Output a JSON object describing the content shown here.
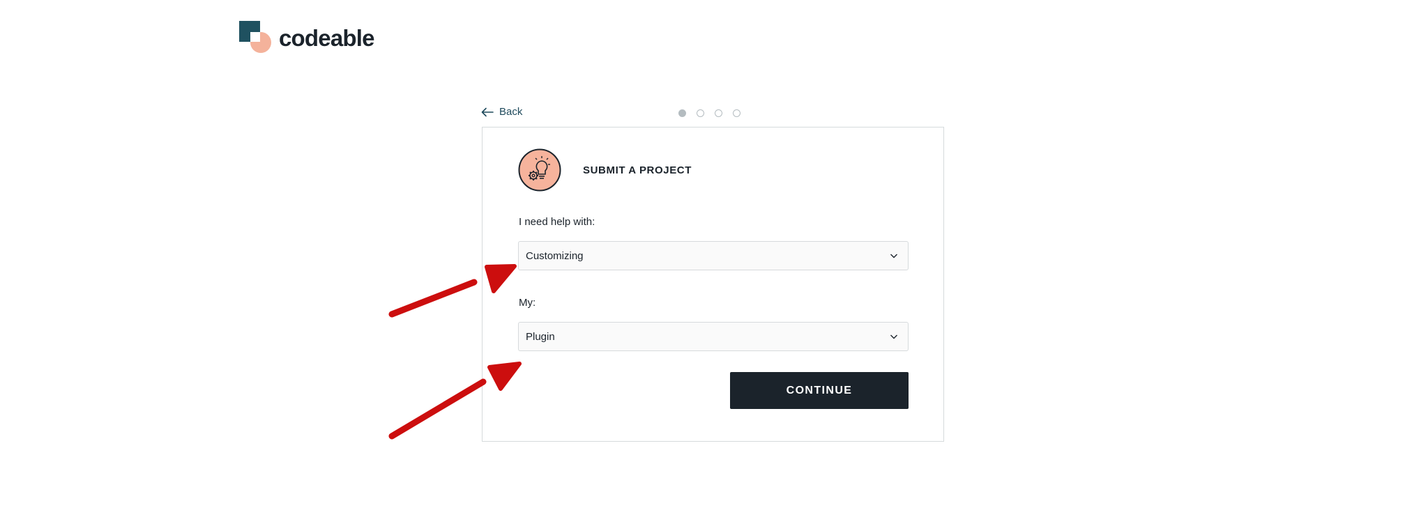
{
  "brand": {
    "name": "codeable",
    "logo_colors": {
      "square": "#1f5160",
      "circle": "#f4b29b",
      "overlap": "#ffffff"
    }
  },
  "nav": {
    "back_label": "Back"
  },
  "progress": {
    "total_steps": 4,
    "current_step": 1
  },
  "card": {
    "icon": "lightbulb-gear-icon",
    "title": "SUBMIT A PROJECT",
    "fields": [
      {
        "label": "I need help with:",
        "value": "Customizing"
      },
      {
        "label": "My:",
        "value": "Plugin"
      }
    ],
    "continue_label": "CONTINUE"
  },
  "annotations": {
    "arrow_color": "#cc0e0e",
    "arrow_count": 2
  },
  "colors": {
    "button_bg": "#1b232b",
    "icon_circle": "#f6b39c",
    "border": "#d6dadc"
  }
}
